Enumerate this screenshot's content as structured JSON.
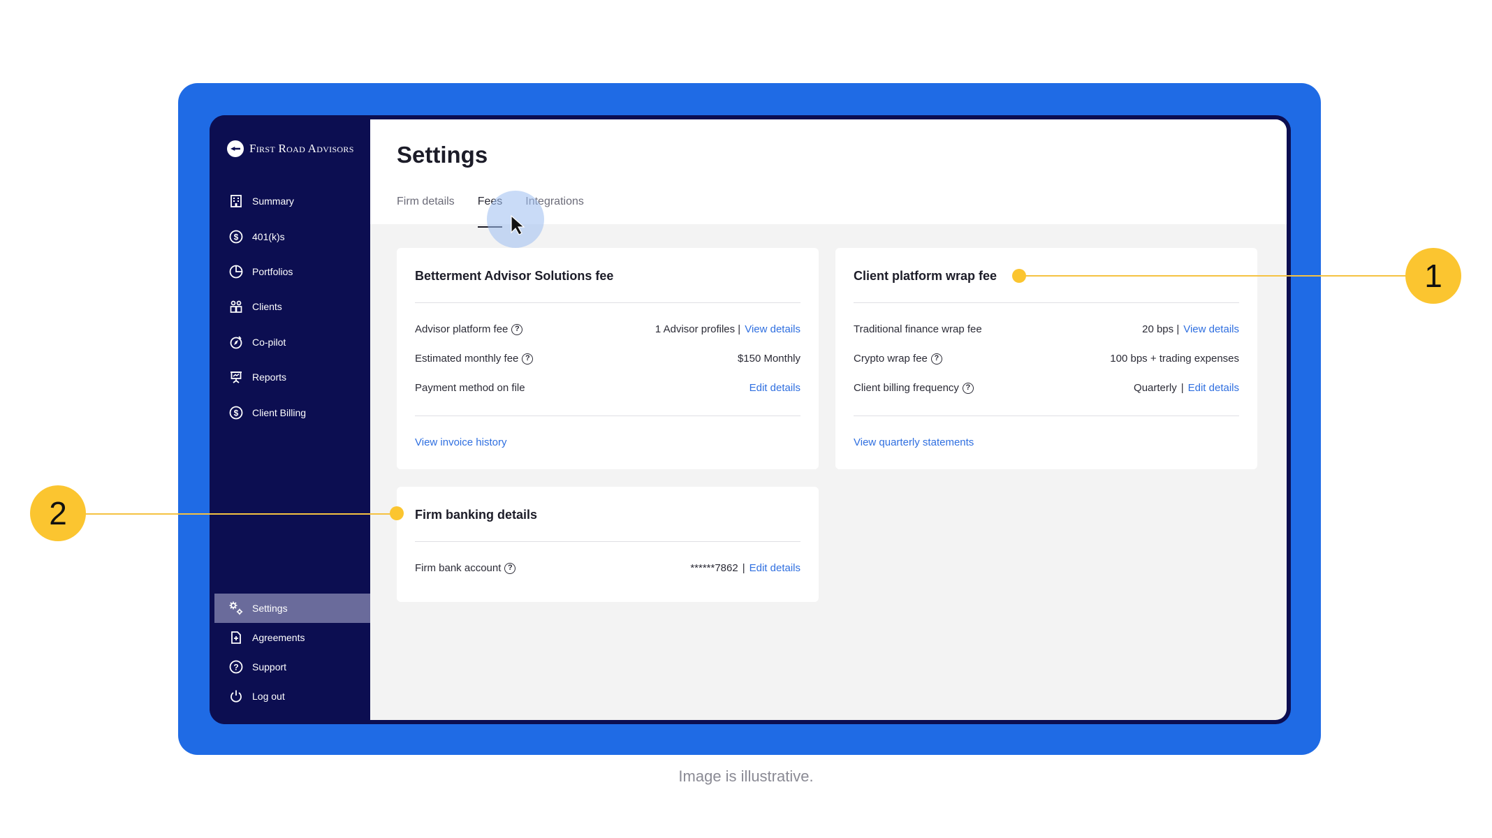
{
  "brand": {
    "name": "First Road Advisors"
  },
  "sidebar": {
    "items": [
      {
        "label": "Summary",
        "icon": "building-icon"
      },
      {
        "label": "401(k)s",
        "icon": "dollar-circle-icon"
      },
      {
        "label": "Portfolios",
        "icon": "pie-chart-icon"
      },
      {
        "label": "Clients",
        "icon": "people-icon"
      },
      {
        "label": "Co-pilot",
        "icon": "compass-icon"
      },
      {
        "label": "Reports",
        "icon": "presentation-icon"
      },
      {
        "label": "Client Billing",
        "icon": "dollar-circle-icon"
      }
    ],
    "bottom_items": [
      {
        "label": "Settings",
        "icon": "gears-icon",
        "active": true
      },
      {
        "label": "Agreements",
        "icon": "document-icon"
      },
      {
        "label": "Support",
        "icon": "question-circle-icon"
      },
      {
        "label": "Log out",
        "icon": "power-icon"
      }
    ]
  },
  "page": {
    "title": "Settings",
    "tabs": [
      {
        "label": "Firm details"
      },
      {
        "label": "Fees",
        "active": true
      },
      {
        "label": "Integrations"
      }
    ]
  },
  "cards": {
    "advisor_fee": {
      "title": "Betterment Advisor Solutions fee",
      "rows": [
        {
          "label": "Advisor platform fee",
          "value": "1 Advisor profiles |",
          "link": "View details"
        },
        {
          "label": "Estimated monthly fee",
          "value": "$150 Monthly"
        },
        {
          "label": "Payment method on file",
          "link": "Edit details"
        }
      ],
      "footer_link": "View invoice history"
    },
    "wrap_fee": {
      "title": "Client platform wrap fee",
      "rows": [
        {
          "label": "Traditional finance wrap fee",
          "value": "20 bps |",
          "link": "View details"
        },
        {
          "label": "Crypto wrap fee",
          "value": "100 bps + trading expenses"
        },
        {
          "label": "Client billing frequency",
          "value": "Quarterly",
          "sep": "|",
          "link": "Edit details"
        }
      ],
      "footer_link": "View quarterly statements"
    },
    "banking": {
      "title": "Firm banking details",
      "rows": [
        {
          "label": "Firm bank account",
          "value": "******7862",
          "sep": "|",
          "link": "Edit details"
        }
      ]
    }
  },
  "callouts": {
    "one": "1",
    "two": "2"
  },
  "caption": "Image is illustrative.",
  "colors": {
    "frame": "#1f6be5",
    "sidebar": "#0c0e51",
    "accent": "#fbc530",
    "link": "#2f6fe0"
  }
}
